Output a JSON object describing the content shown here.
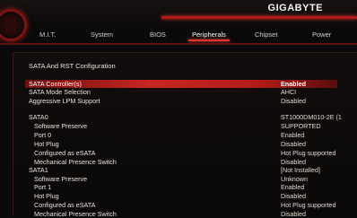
{
  "brand": "GIGABYTE",
  "tabs": [
    "M.I.T.",
    "System",
    "BIOS",
    "Peripherals",
    "Chipset",
    "Power"
  ],
  "active_tab": "Peripherals",
  "section_title": "SATA And RST Configuration",
  "rows": [
    {
      "label": "SATA Controller(s)",
      "value": "Enabled",
      "selected": true,
      "indent": false
    },
    {
      "label": "SATA Mode Selection",
      "value": "AHCI",
      "selected": false,
      "indent": false
    },
    {
      "label": "Aggressive LPM Support",
      "value": "Disabled",
      "selected": false,
      "indent": false
    },
    {
      "label": "SATA0",
      "value": "ST1000DM010-2E (1",
      "selected": false,
      "indent": false
    },
    {
      "label": "Software Preserve",
      "value": "SUPPORTED",
      "selected": false,
      "indent": true
    },
    {
      "label": "Port 0",
      "value": "Enabled",
      "selected": false,
      "indent": true
    },
    {
      "label": "Hot Plug",
      "value": "Disabled",
      "selected": false,
      "indent": true
    },
    {
      "label": "Configured as eSATA",
      "value": "Hot Plug supported",
      "selected": false,
      "indent": true
    },
    {
      "label": "Mechanical Presence Switch",
      "value": "Disabled",
      "selected": false,
      "indent": true
    },
    {
      "label": "SATA1",
      "value": "[Not Installed]",
      "selected": false,
      "indent": false
    },
    {
      "label": "Software Preserve",
      "value": "Unknown",
      "selected": false,
      "indent": true
    },
    {
      "label": "Port 1",
      "value": "Enabled",
      "selected": false,
      "indent": true
    },
    {
      "label": "Hot Plug",
      "value": "Disabled",
      "selected": false,
      "indent": true
    },
    {
      "label": "Configured as eSATA",
      "value": "Hot Plug supported",
      "selected": false,
      "indent": true
    },
    {
      "label": "Mechanical Presence Switch",
      "value": "Disabled",
      "selected": false,
      "indent": true
    }
  ],
  "colors": {
    "accent": "#c82622",
    "background": "#0b0a0a",
    "text": "#e8e2dc"
  }
}
